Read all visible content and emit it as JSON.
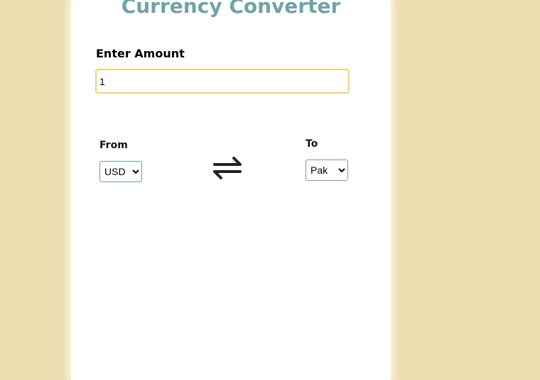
{
  "app": {
    "title": "Currency Converter"
  },
  "amount": {
    "label": "Enter Amount",
    "value": "1"
  },
  "from": {
    "label": "From",
    "selected": "USD"
  },
  "to": {
    "label": "To",
    "selected": "Pak"
  },
  "icons": {
    "swap": "swap-arrows-icon"
  },
  "colors": {
    "page_background": "#ecdeb0",
    "card_background": "#ffffff",
    "title": "#6fa3a8",
    "input_border": "#f0d077",
    "select_border": "#6b9fa6"
  }
}
